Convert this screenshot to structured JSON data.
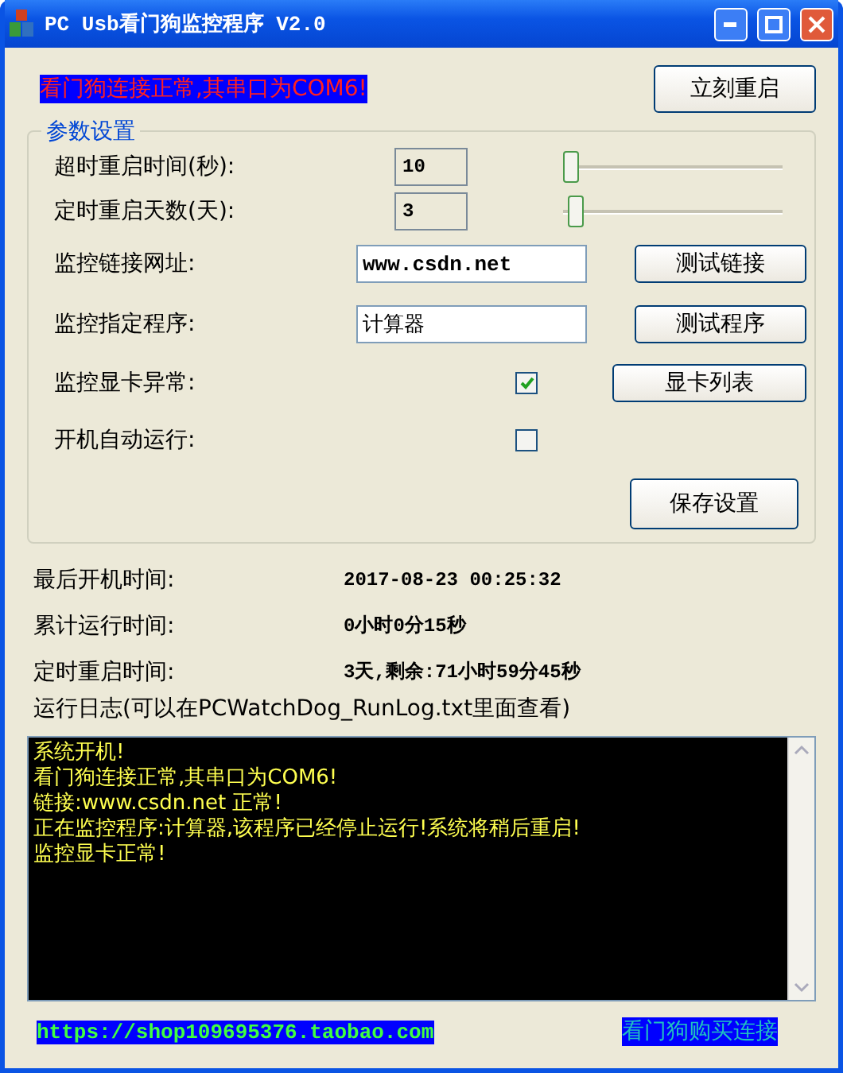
{
  "window": {
    "title": "PC Usb看门狗监控程序 V2.0"
  },
  "status_message": "看门狗连接正常,其串口为COM6!",
  "restart_button": "立刻重启",
  "settings": {
    "title": "参数设置",
    "rows": [
      {
        "kind": "slider",
        "label": "超时重启时间(秒):",
        "value": "10",
        "level": 0.0
      },
      {
        "kind": "slider",
        "label": "定时重启天数(天):",
        "value": "3",
        "level": 0.02
      },
      {
        "kind": "text",
        "label": "监控链接网址:",
        "value": "www.csdn.net",
        "button": "测试链接"
      },
      {
        "kind": "text",
        "label": "监控指定程序:",
        "value": "计算器",
        "button": "测试程序"
      },
      {
        "kind": "checkbox",
        "label": "监控显卡异常:",
        "checked": true,
        "button": "显卡列表"
      },
      {
        "kind": "checkbox",
        "label": "开机自动运行:",
        "checked": false
      }
    ],
    "save_button": "保存设置"
  },
  "info": [
    {
      "label": "最后开机时间:",
      "value": "2017-08-23 00:25:32"
    },
    {
      "label": "累计运行时间:",
      "value": "0小时0分15秒"
    },
    {
      "label": "定时重启时间:",
      "value": "3天,剩余:71小时59分45秒"
    }
  ],
  "log": {
    "title": "运行日志(可以在PCWatchDog_RunLog.txt里面查看)",
    "lines": [
      "系统开机!",
      "看门狗连接正常,其串口为COM6!",
      "链接:www.csdn.net 正常!",
      "正在监控程序:计算器,该程序已经停止运行!系统将稍后重启!",
      "监控显卡正常!"
    ]
  },
  "footer": {
    "shop_link": "https://shop109695376.taobao.com",
    "buy_link": "看门狗购买连接"
  }
}
